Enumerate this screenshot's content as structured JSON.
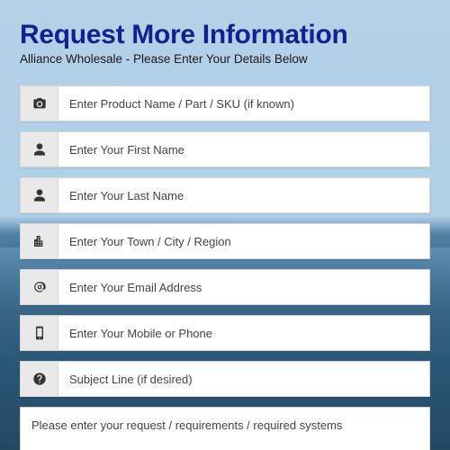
{
  "header": {
    "title": "Request More Information",
    "subtitle": "Alliance Wholesale - Please Enter Your Details Below"
  },
  "fields": {
    "product": {
      "placeholder": "Enter Product Name / Part / SKU (if known)",
      "value": ""
    },
    "firstName": {
      "placeholder": "Enter Your First Name",
      "value": ""
    },
    "lastName": {
      "placeholder": "Enter Your Last Name",
      "value": ""
    },
    "town": {
      "placeholder": "Enter Your Town / City / Region",
      "value": ""
    },
    "email": {
      "placeholder": "Enter Your Email Address",
      "value": ""
    },
    "phone": {
      "placeholder": "Enter Your Mobile or Phone",
      "value": ""
    },
    "subject": {
      "placeholder": "Subject Line (if desired)",
      "value": ""
    },
    "message": {
      "placeholder": "Please enter your request / requirements / required systems",
      "value": ""
    }
  }
}
